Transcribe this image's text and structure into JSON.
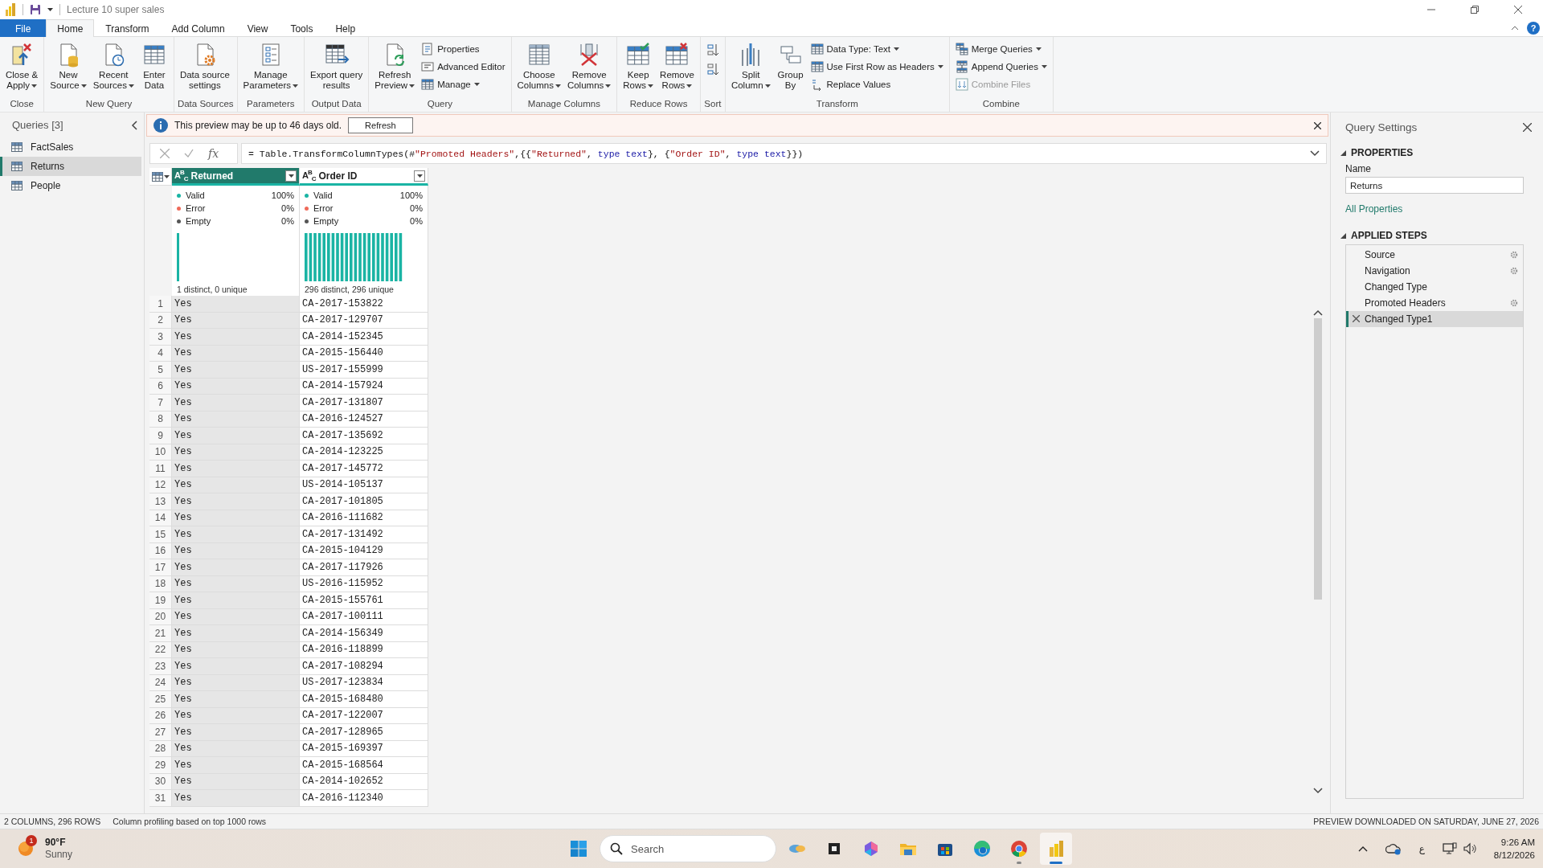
{
  "window": {
    "title": "Lecture 10 super sales"
  },
  "ribbon_tabs": [
    {
      "label": "File",
      "kind": "file",
      "selected": false
    },
    {
      "label": "Home",
      "kind": "tab",
      "selected": true
    },
    {
      "label": "Transform",
      "kind": "tab",
      "selected": false
    },
    {
      "label": "Add Column",
      "kind": "tab",
      "selected": false
    },
    {
      "label": "View",
      "kind": "tab",
      "selected": false
    },
    {
      "label": "Tools",
      "kind": "tab",
      "selected": false
    },
    {
      "label": "Help",
      "kind": "tab",
      "selected": false
    }
  ],
  "help": "?",
  "ribbon_groups": [
    {
      "label": "Close",
      "commands": [
        {
          "kind": "large",
          "label": "Close &\nApply",
          "dropdown": true
        }
      ]
    },
    {
      "label": "New Query",
      "commands": [
        {
          "kind": "large",
          "label": "New\nSource",
          "dropdown": true
        },
        {
          "kind": "large",
          "label": "Recent\nSources",
          "dropdown": true
        },
        {
          "kind": "large",
          "label": "Enter\nData",
          "dropdown": false
        }
      ]
    },
    {
      "label": "Data Sources",
      "commands": [
        {
          "kind": "large",
          "label": "Data source\nsettings",
          "dropdown": false
        }
      ]
    },
    {
      "label": "Parameters",
      "commands": [
        {
          "kind": "large",
          "label": "Manage\nParameters",
          "dropdown": true
        }
      ]
    },
    {
      "label": "Output Data",
      "commands": [
        {
          "kind": "large",
          "label": "Export query\nresults",
          "dropdown": false
        }
      ]
    },
    {
      "label": "Query",
      "commands": [
        {
          "kind": "large",
          "label": "Refresh\nPreview",
          "dropdown": true
        },
        {
          "kind": "small",
          "label": "Properties",
          "dropdown": false,
          "disabled": false
        },
        {
          "kind": "small",
          "label": "Advanced Editor",
          "dropdown": false,
          "disabled": false
        },
        {
          "kind": "small",
          "label": "Manage",
          "dropdown": true,
          "disabled": false
        }
      ]
    },
    {
      "label": "Manage Columns",
      "commands": [
        {
          "kind": "large",
          "label": "Choose\nColumns",
          "dropdown": true
        },
        {
          "kind": "large",
          "label": "Remove\nColumns",
          "dropdown": true
        }
      ]
    },
    {
      "label": "Reduce Rows",
      "commands": [
        {
          "kind": "large",
          "label": "Keep\nRows",
          "dropdown": true
        },
        {
          "kind": "large",
          "label": "Remove\nRows",
          "dropdown": true
        }
      ]
    },
    {
      "label": "Sort",
      "commands": [
        {
          "kind": "icon"
        },
        {
          "kind": "icon"
        }
      ]
    },
    {
      "label": "Transform",
      "commands": [
        {
          "kind": "large",
          "label": "Split\nColumn",
          "dropdown": true
        },
        {
          "kind": "large",
          "label": "Group\nBy",
          "dropdown": false
        },
        {
          "kind": "small",
          "label": "Data Type: Text",
          "dropdown": true,
          "disabled": false
        },
        {
          "kind": "small",
          "label": "Use First Row as Headers",
          "dropdown": true,
          "disabled": false
        },
        {
          "kind": "small",
          "label": "Replace Values",
          "dropdown": false,
          "disabled": false
        }
      ]
    },
    {
      "label": "Combine",
      "commands": [
        {
          "kind": "small",
          "label": "Merge Queries",
          "dropdown": true,
          "disabled": false
        },
        {
          "kind": "small",
          "label": "Append Queries",
          "dropdown": true,
          "disabled": false
        },
        {
          "kind": "small",
          "label": "Combine Files",
          "dropdown": false,
          "disabled": true
        }
      ]
    }
  ],
  "queries": {
    "title": "Queries [3]",
    "items": [
      {
        "label": "FactSales",
        "selected": false
      },
      {
        "label": "Returns",
        "selected": true
      },
      {
        "label": "People",
        "selected": false
      }
    ]
  },
  "info_bar": {
    "message": "This preview may be up to 46 days old.",
    "button": "Refresh"
  },
  "formula_bar": {
    "fx": "fx",
    "segments": [
      {
        "kind": "plain",
        "text": "= Table.TransformColumnTypes(#"
      },
      {
        "kind": "string",
        "text": "\"Promoted Headers\""
      },
      {
        "kind": "plain",
        "text": ",{{"
      },
      {
        "kind": "string",
        "text": "\"Returned\""
      },
      {
        "kind": "plain",
        "text": ", "
      },
      {
        "kind": "keyword",
        "text": "type text"
      },
      {
        "kind": "plain",
        "text": "}, {"
      },
      {
        "kind": "string",
        "text": "\"Order ID\""
      },
      {
        "kind": "plain",
        "text": ", "
      },
      {
        "kind": "keyword",
        "text": "type text"
      },
      {
        "kind": "plain",
        "text": "}})"
      }
    ]
  },
  "table": {
    "columns": [
      {
        "name": "Returned",
        "type_label": "A$^{B}$$_{C}$",
        "selected": true,
        "quality": [
          {
            "kind": "valid",
            "label": "Valid",
            "value": "100%"
          },
          {
            "kind": "error",
            "label": "Error",
            "value": "0%"
          },
          {
            "kind": "empty",
            "label": "Empty",
            "value": "0%"
          }
        ],
        "distinct": "1 distinct, 0 unique"
      },
      {
        "name": "Order ID",
        "type_label": "A$^{B}$$_{C}$",
        "selected": false,
        "quality": [
          {
            "kind": "valid",
            "label": "Valid",
            "value": "100%"
          },
          {
            "kind": "error",
            "label": "Error",
            "value": "0%"
          },
          {
            "kind": "empty",
            "label": "Empty",
            "value": "0%"
          }
        ],
        "distinct": "296 distinct, 296 unique"
      }
    ],
    "rows": [
      {
        "index": "1",
        "cells": [
          "Yes",
          "CA-2017-153822"
        ]
      },
      {
        "index": "2",
        "cells": [
          "Yes",
          "CA-2017-129707"
        ]
      },
      {
        "index": "3",
        "cells": [
          "Yes",
          "CA-2014-152345"
        ]
      },
      {
        "index": "4",
        "cells": [
          "Yes",
          "CA-2015-156440"
        ]
      },
      {
        "index": "5",
        "cells": [
          "Yes",
          "US-2017-155999"
        ]
      },
      {
        "index": "6",
        "cells": [
          "Yes",
          "CA-2014-157924"
        ]
      },
      {
        "index": "7",
        "cells": [
          "Yes",
          "CA-2017-131807"
        ]
      },
      {
        "index": "8",
        "cells": [
          "Yes",
          "CA-2016-124527"
        ]
      },
      {
        "index": "9",
        "cells": [
          "Yes",
          "CA-2017-135692"
        ]
      },
      {
        "index": "10",
        "cells": [
          "Yes",
          "CA-2014-123225"
        ]
      },
      {
        "index": "11",
        "cells": [
          "Yes",
          "CA-2017-145772"
        ]
      },
      {
        "index": "12",
        "cells": [
          "Yes",
          "US-2014-105137"
        ]
      },
      {
        "index": "13",
        "cells": [
          "Yes",
          "CA-2017-101805"
        ]
      },
      {
        "index": "14",
        "cells": [
          "Yes",
          "CA-2016-111682"
        ]
      },
      {
        "index": "15",
        "cells": [
          "Yes",
          "CA-2017-131492"
        ]
      },
      {
        "index": "16",
        "cells": [
          "Yes",
          "CA-2015-104129"
        ]
      },
      {
        "index": "17",
        "cells": [
          "Yes",
          "CA-2017-117926"
        ]
      },
      {
        "index": "18",
        "cells": [
          "Yes",
          "US-2016-115952"
        ]
      },
      {
        "index": "19",
        "cells": [
          "Yes",
          "CA-2015-155761"
        ]
      },
      {
        "index": "20",
        "cells": [
          "Yes",
          "CA-2017-100111"
        ]
      },
      {
        "index": "21",
        "cells": [
          "Yes",
          "CA-2014-156349"
        ]
      },
      {
        "index": "22",
        "cells": [
          "Yes",
          "CA-2016-118899"
        ]
      },
      {
        "index": "23",
        "cells": [
          "Yes",
          "CA-2017-108294"
        ]
      },
      {
        "index": "24",
        "cells": [
          "Yes",
          "US-2017-123834"
        ]
      },
      {
        "index": "25",
        "cells": [
          "Yes",
          "CA-2015-168480"
        ]
      },
      {
        "index": "26",
        "cells": [
          "Yes",
          "CA-2017-122007"
        ]
      },
      {
        "index": "27",
        "cells": [
          "Yes",
          "CA-2017-128965"
        ]
      },
      {
        "index": "28",
        "cells": [
          "Yes",
          "CA-2015-169397"
        ]
      },
      {
        "index": "29",
        "cells": [
          "Yes",
          "CA-2015-168564"
        ]
      },
      {
        "index": "30",
        "cells": [
          "Yes",
          "CA-2014-102652"
        ]
      },
      {
        "index": "31",
        "cells": [
          "Yes",
          "CA-2016-112340"
        ]
      }
    ]
  },
  "query_settings": {
    "title": "Query Settings",
    "properties_heading": "PROPERTIES",
    "name_label": "Name",
    "name_value": "Returns",
    "all_properties": "All Properties",
    "steps_heading": "APPLIED STEPS",
    "steps": [
      {
        "label": "Source",
        "settings": true,
        "selected": false
      },
      {
        "label": "Navigation",
        "settings": true,
        "selected": false
      },
      {
        "label": "Changed Type",
        "settings": false,
        "selected": false
      },
      {
        "label": "Promoted Headers",
        "settings": true,
        "selected": false
      },
      {
        "label": "Changed Type1",
        "settings": false,
        "selected": true
      }
    ]
  },
  "status_bar": {
    "counts": "2 COLUMNS, 296 ROWS",
    "profiling": "Column profiling based on top 1000 rows",
    "downloaded": "PREVIEW DOWNLOADED ON SATURDAY, JUNE 27, 2026"
  },
  "taskbar": {
    "weather": {
      "badge": "1",
      "temperature": "90°F",
      "condition": "Sunny"
    },
    "search": {
      "placeholder": "Search"
    },
    "apps": [
      {
        "running": false,
        "active": false
      },
      {
        "running": false,
        "active": false
      },
      {
        "running": false,
        "active": false
      },
      {
        "running": false,
        "active": false
      },
      {
        "running": false,
        "active": false
      },
      {
        "running": false,
        "active": false
      },
      {
        "running": true,
        "active": false
      },
      {
        "running": true,
        "active": true
      }
    ],
    "language": "ع",
    "time": "9:26 AM",
    "date": "8/12/2026"
  }
}
